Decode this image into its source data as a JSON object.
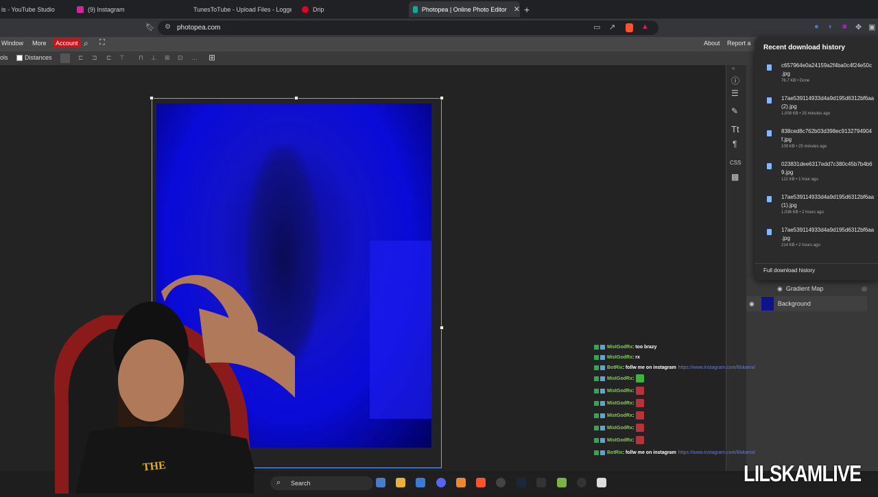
{
  "tabs": [
    {
      "label": "is - YouTube Studio",
      "color": "#cc2222"
    },
    {
      "label": "(9) Instagram",
      "color": "#d6249f"
    },
    {
      "label": "TunesToTube - Upload Files - Logged In",
      "color": "#888888"
    },
    {
      "label": "Drip",
      "color": "#e60023"
    },
    {
      "label": "Photopea | Online Photo Editor",
      "color": "#18a497"
    }
  ],
  "url": "photopea.com",
  "menu": {
    "window": "Window",
    "more": "More",
    "account": "Account",
    "about": "About",
    "report": "Report a"
  },
  "options": {
    "tools": "ols",
    "distances": "Distances"
  },
  "downloads": {
    "title": "Recent download history",
    "items": [
      {
        "name": "c657964e0a24159a2f4ba0c4f24e50c\n.jpg",
        "meta": "76.7 KB • Done"
      },
      {
        "name": "17ae539114933d4a9d195d6312bf6aa\n(2).jpg",
        "meta": "1,008 KB • 25 minutes ago"
      },
      {
        "name": "838ced8c762b03d398ec9132794904\nf.jpg",
        "meta": "109 KB • 25 minutes ago"
      },
      {
        "name": "023831dee6317edd7c380c45b7b4b6\n9.jpg",
        "meta": "122 KB • 1 hour ago"
      },
      {
        "name": "17ae539114933d4a9d195d6312bf6aa\n(1).jpg",
        "meta": "1,036 KB • 2 hours ago"
      },
      {
        "name": "17ae539114933d4a9d195d6312bf6aa\n.jpg",
        "meta": "214 KB • 2 hours ago"
      }
    ],
    "full": "Full download history"
  },
  "layers": [
    {
      "name": "Gradient Map"
    },
    {
      "name": "Background"
    }
  ],
  "chat": [
    {
      "user": "MistGodRx",
      "msg": ": too brazy",
      "color": "#7fd14a",
      "link": ""
    },
    {
      "user": "MistGodRx",
      "msg": ": rx",
      "color": "#7fd14a",
      "link": ""
    },
    {
      "user": "BotRix",
      "msg": ": follw me on instagram",
      "color": "#7fd14a",
      "link": "https://www.instagram.com/lilskamx/"
    },
    {
      "user": "MistGodRx",
      "msg": ":",
      "color": "#7fd14a",
      "link": "",
      "emote": "#3cb33c"
    },
    {
      "user": "MistGodRx",
      "msg": ":",
      "color": "#7fd14a",
      "link": "",
      "emote": "#b8323c"
    },
    {
      "user": "MistGodRx",
      "msg": ":",
      "color": "#7fd14a",
      "link": "",
      "emote": "#b8323c"
    },
    {
      "user": "MistGodRx",
      "msg": ":",
      "color": "#7fd14a",
      "link": "",
      "emote": "#b8323c"
    },
    {
      "user": "MistGodRx",
      "msg": ":",
      "color": "#7fd14a",
      "link": "",
      "emote": "#b8323c"
    },
    {
      "user": "MistGodRx",
      "msg": ":",
      "color": "#7fd14a",
      "link": "",
      "emote": "#b8323c"
    },
    {
      "user": "BotRix",
      "msg": ": follw me on instagram",
      "color": "#7fd14a",
      "link": "https://www.instagram.com/lilskamx/"
    }
  ],
  "taskbar": {
    "search": "Search"
  },
  "brand": "LILSKAMLIVE",
  "webcam_shirt": "THE"
}
